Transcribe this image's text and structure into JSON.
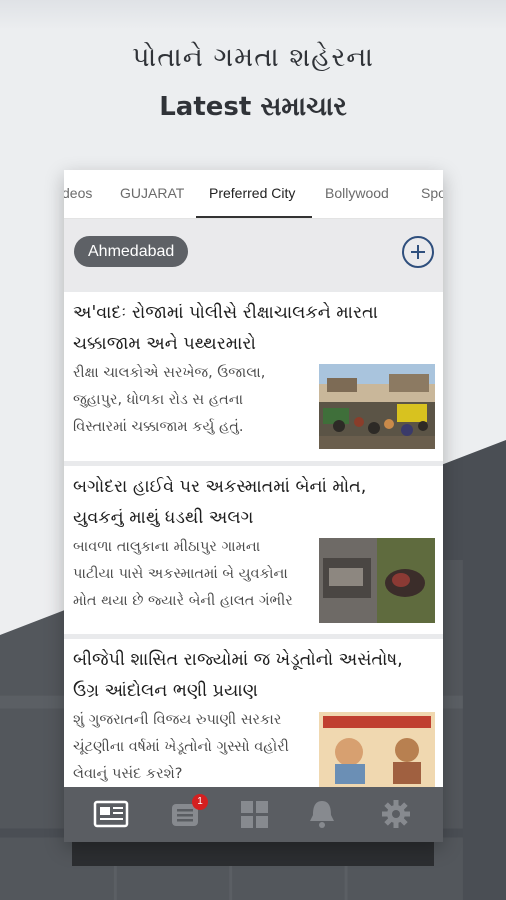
{
  "promo": {
    "line1": "પોતાને ગમતા શહેરના",
    "line2": "Latest સમાચાર"
  },
  "tabs": [
    {
      "label": "deos"
    },
    {
      "label": "GUJARAT"
    },
    {
      "label": "Preferred City",
      "active": true
    },
    {
      "label": "Bollywood"
    },
    {
      "label": "Spo"
    }
  ],
  "filter": {
    "city": "Ahmedabad",
    "add_icon": "plus-circle-icon"
  },
  "articles": [
    {
      "title_line1": "અ'વાદઃ રોજામાં પોલીસે રીક્ષાચાલકને મારતા",
      "title_line2": "ચક્કાજામ અને પથ્થરમારો",
      "desc_line1": "રીક્ષા ચાલકોએ સરખેજ, ઉજાલા,",
      "desc_line2": "જુહાપુર, ધોળકા રોડ સ   હતના",
      "desc_line3": "વિસ્તારમાં ચક્કાજામ કર્યુ હતું."
    },
    {
      "title_line1": "બગોદરા હાઈવે પર અકસ્માતમાં બેનાં મોત,",
      "title_line2": "યુવકનું માથું ધડથી અલગ",
      "desc_line1": "બાવળા તાલુકાના મીઠાપુર ગામના",
      "desc_line2": "પાટીયા પાસે અકસ્માતમાં બે યુવકોના",
      "desc_line3": "મોત થયા છે જ્યારે બેની હાલત ગંભીર"
    },
    {
      "title_line1": "બીજેપી શાસિત રાજ્યોમાં જ ખેડૂતોનો અસંતોષ,",
      "title_line2": "ઉગ્ર આંદોલન ભણી પ્રયાણ",
      "desc_line1": "શું ગુજરાતની વિજય રુપાણી સરકાર",
      "desc_line2": "ચૂંટણીના વર્ષમાં ખેડૂતોનો ગુસ્સો વહોરી",
      "desc_line3": "લેવાનું પસંદ કરશે?"
    }
  ],
  "bottom_nav": {
    "items": [
      "newspaper-icon",
      "list-icon",
      "grid-icon",
      "bell-icon",
      "gear-icon"
    ],
    "badge_count": "1"
  },
  "colors": {
    "accent": "#2f4f7d",
    "nav_bg": "#5a5d62",
    "badge": "#d42020",
    "dark_bg": "#4a4e54"
  }
}
